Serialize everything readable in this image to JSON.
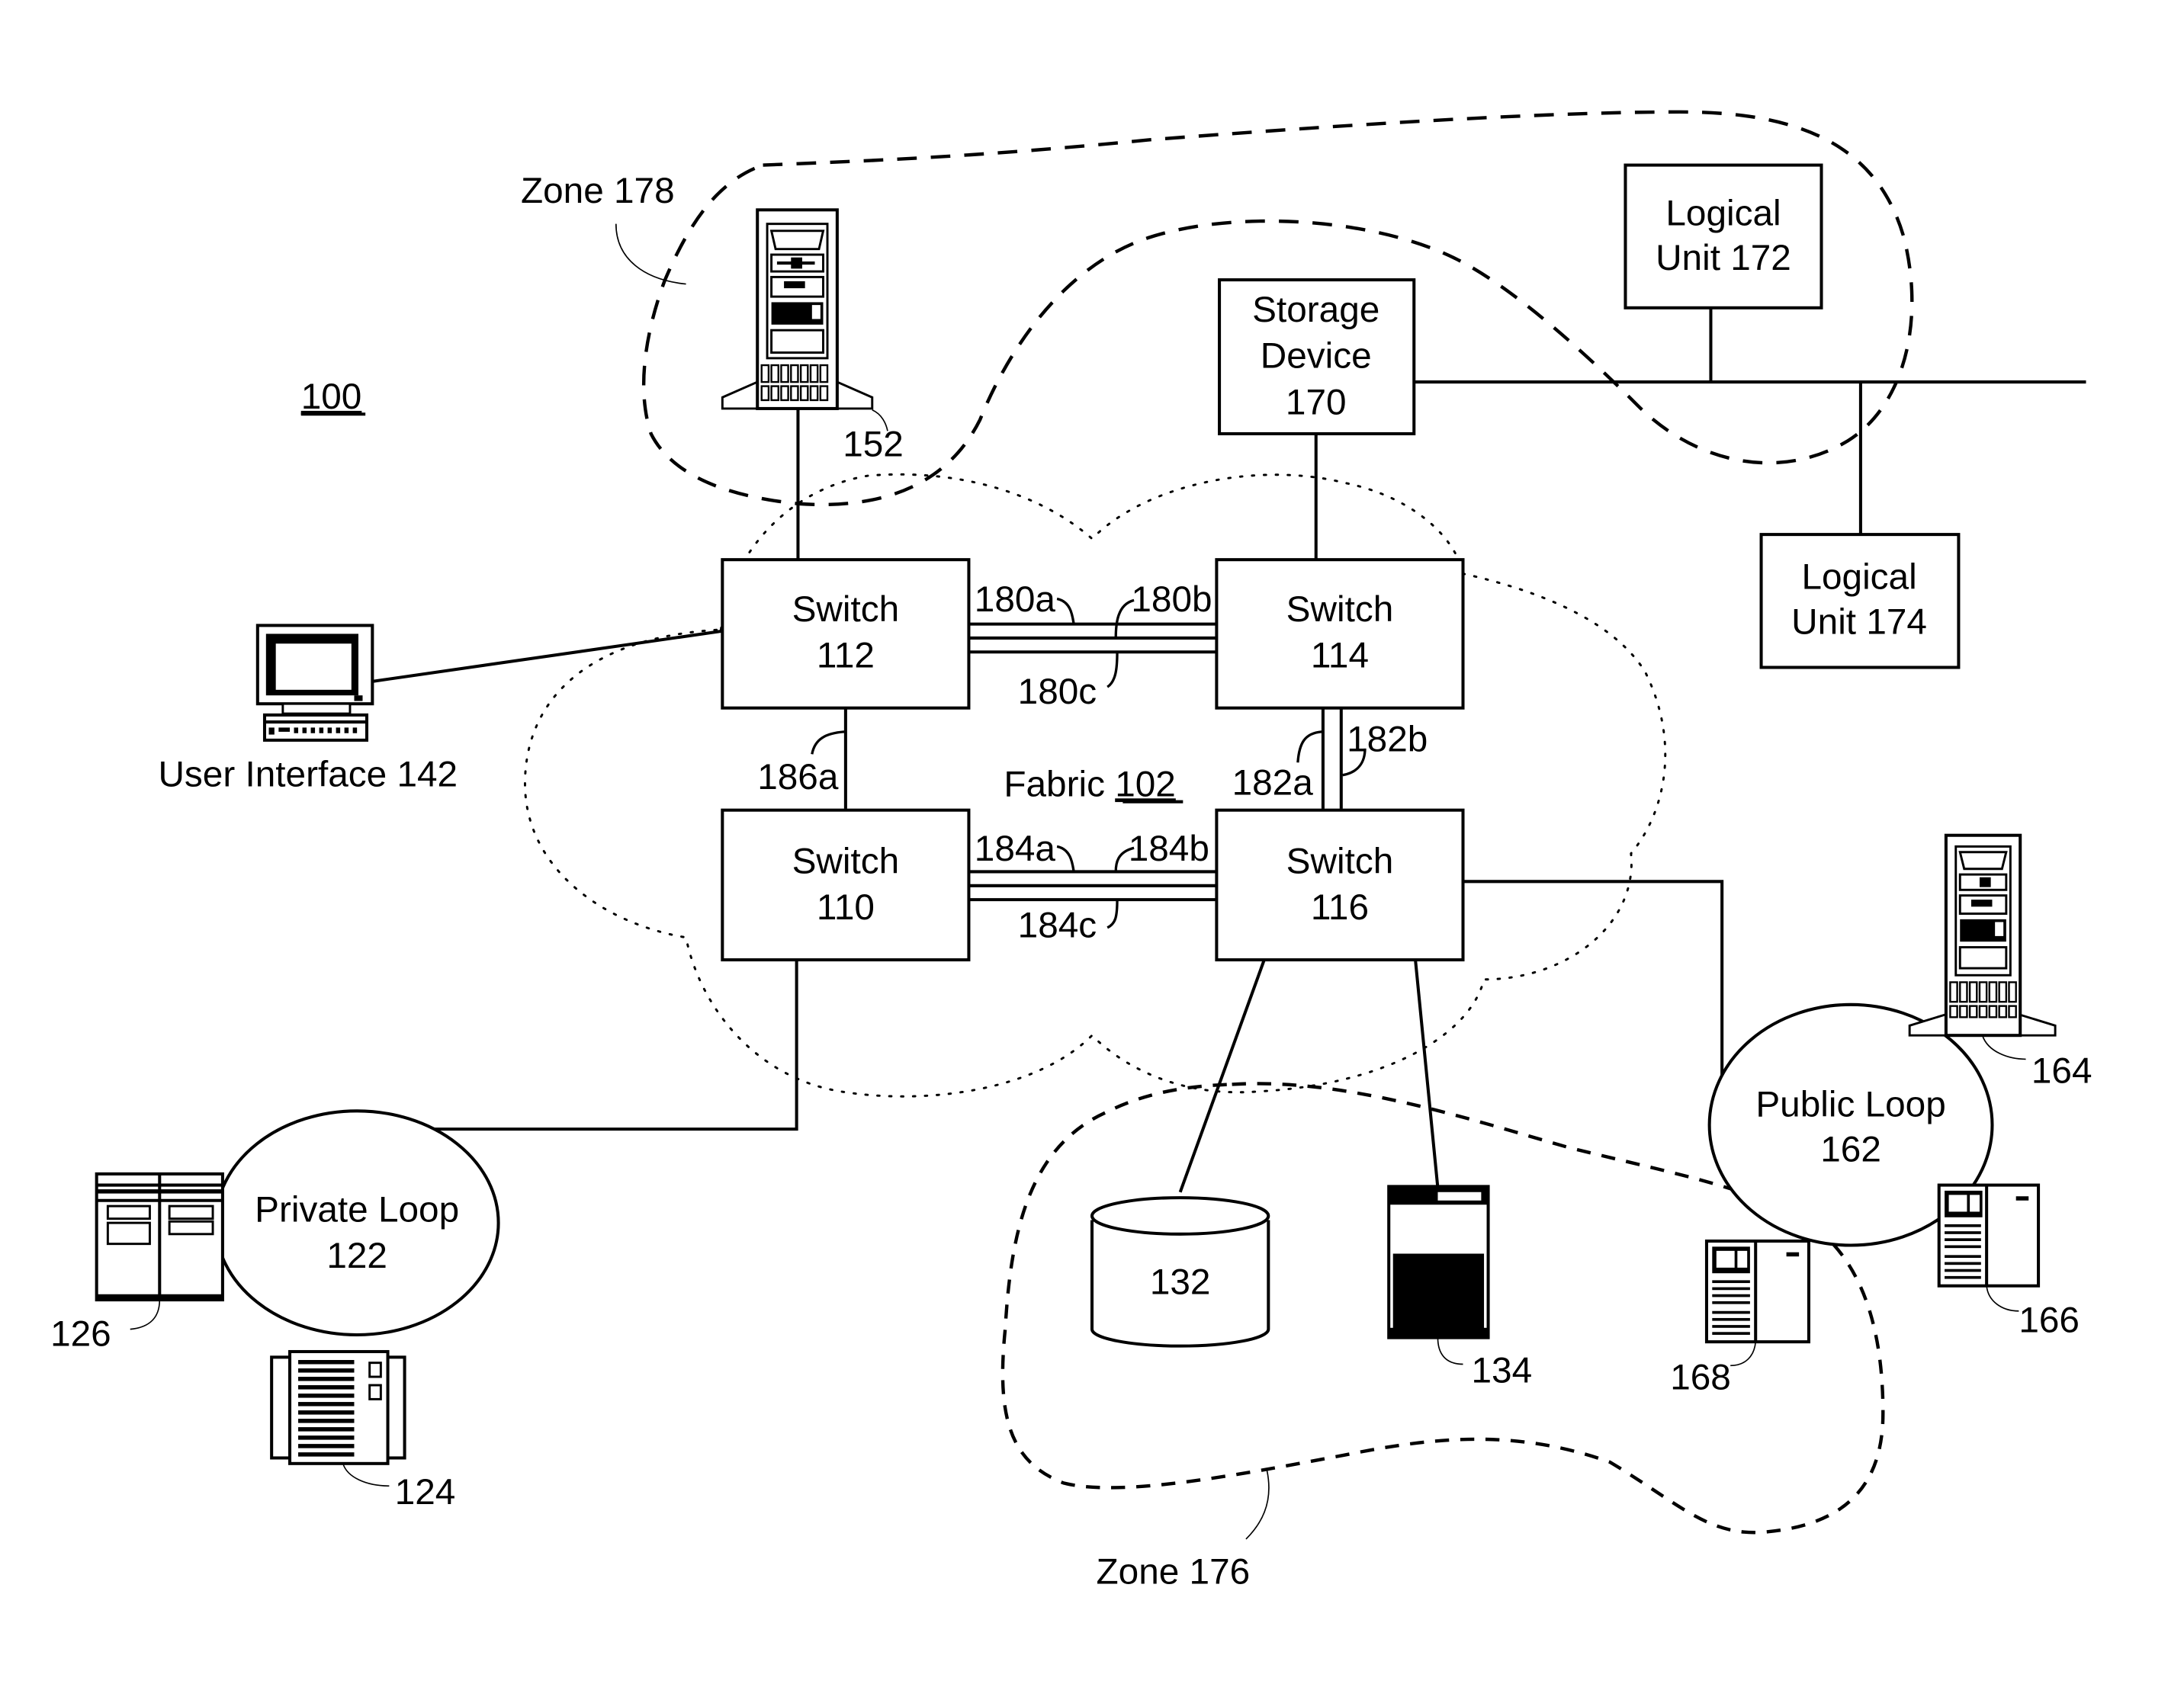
{
  "figure": {
    "ref": "100",
    "fabric": {
      "label": "Fabric",
      "ref": "102"
    }
  },
  "zones": [
    {
      "id": "zone-178",
      "label": "Zone 178"
    },
    {
      "id": "zone-176",
      "label": "Zone 176"
    }
  ],
  "switches": [
    {
      "id": "switch-112",
      "line1": "Switch",
      "line2": "112"
    },
    {
      "id": "switch-114",
      "line1": "Switch",
      "line2": "114"
    },
    {
      "id": "switch-110",
      "line1": "Switch",
      "line2": "110"
    },
    {
      "id": "switch-116",
      "line1": "Switch",
      "line2": "116"
    }
  ],
  "links": {
    "l180a": "180a",
    "l180b": "180b",
    "l180c": "180c",
    "l182a": "182a",
    "l182b": "182b",
    "l184a": "184a",
    "l184b": "184b",
    "l184c": "184c",
    "l186a": "186a"
  },
  "storage": {
    "line1": "Storage",
    "line2": "Device",
    "line3": "170"
  },
  "logical_units": [
    {
      "id": "lu-172",
      "line1": "Logical",
      "line2": "Unit 172"
    },
    {
      "id": "lu-174",
      "line1": "Logical",
      "line2": "Unit 174"
    }
  ],
  "loops": [
    {
      "id": "private-loop",
      "line1": "Private Loop",
      "line2": "122"
    },
    {
      "id": "public-loop",
      "line1": "Public Loop",
      "line2": "162"
    }
  ],
  "devices": {
    "server152": "152",
    "user_interface": "User Interface 142",
    "disk132": "132",
    "dev134": "134",
    "dev124": "124",
    "dev126": "126",
    "server164": "164",
    "dev166": "166",
    "dev168": "168"
  }
}
